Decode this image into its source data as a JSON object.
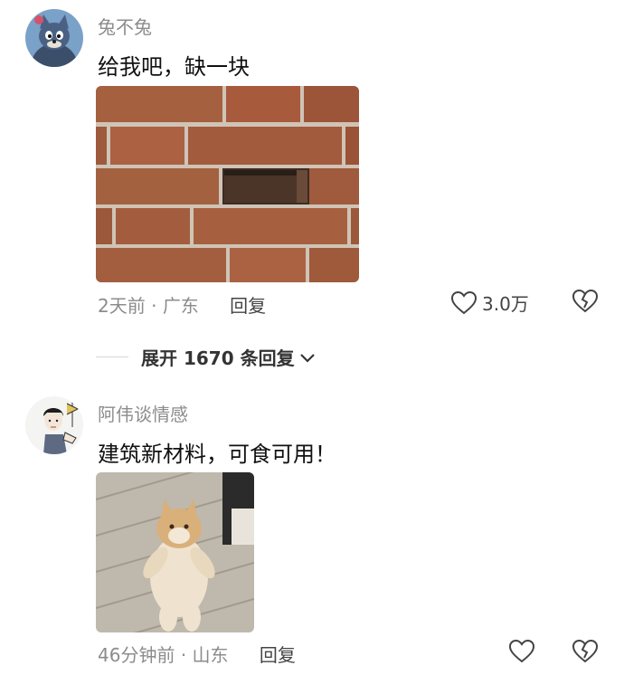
{
  "comments": [
    {
      "username": "兔不兔",
      "text": "给我吧，缺一块",
      "time": "2天前",
      "separator": "·",
      "location": "广东",
      "reply_label": "回复",
      "likes": "3.0万"
    },
    {
      "username": "阿伟谈情感",
      "text": "建筑新材料，可食可用！",
      "time": "46分钟前",
      "separator": "·",
      "location": "山东",
      "reply_label": "回复",
      "likes": ""
    }
  ],
  "expand_replies": {
    "label": "展开 1670 条回复"
  },
  "colors": {
    "meta_gray": "#8c8c8c",
    "text": "#111111",
    "brick": "#a0583b",
    "mortar": "#cfc4b6"
  }
}
